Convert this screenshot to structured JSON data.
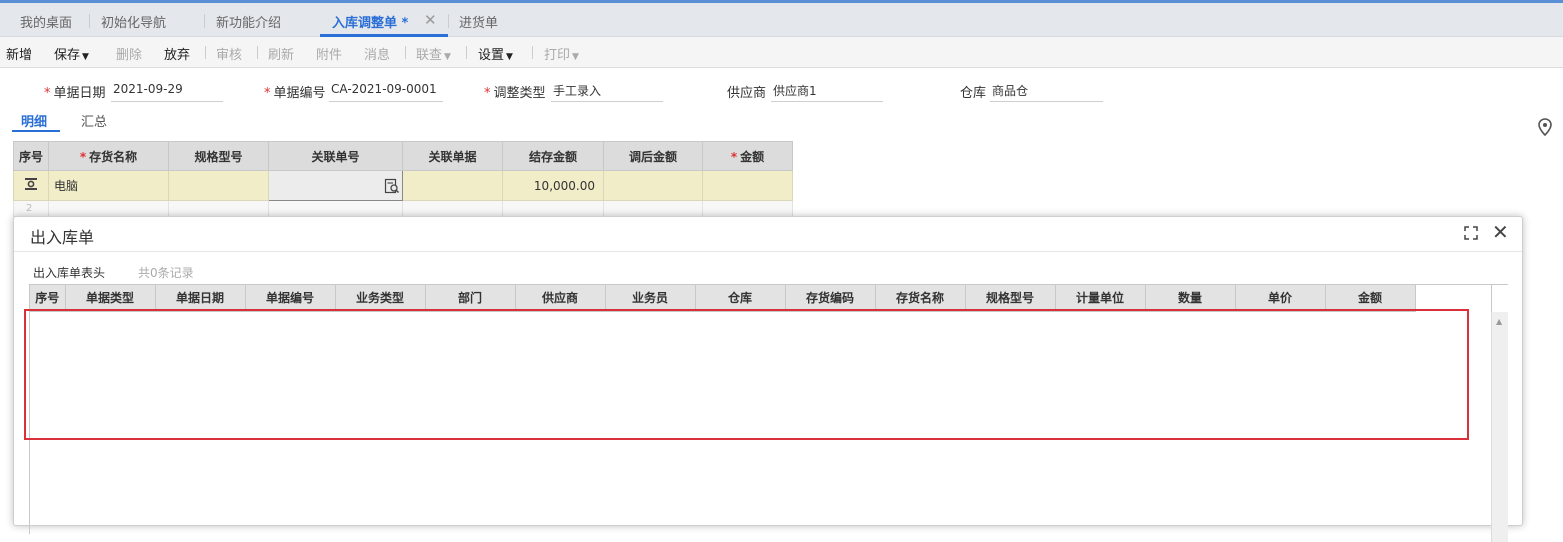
{
  "tabs": [
    {
      "label": "我的桌面"
    },
    {
      "label": "初始化导航"
    },
    {
      "label": "新功能介绍"
    },
    {
      "label": "入库调整单 *"
    },
    {
      "label": "进货单"
    }
  ],
  "toolbar": {
    "new": "新增",
    "save": "保存",
    "delete": "删除",
    "discard": "放弃",
    "audit": "审核",
    "refresh": "刷新",
    "attach": "附件",
    "message": "消息",
    "linked": "联查",
    "settings": "设置",
    "print": "打印"
  },
  "form": {
    "date_label": "单据日期",
    "date_value": "2021-09-29",
    "code_label": "单据编号",
    "code_value": "CA-2021-09-0001",
    "type_label": "调整类型",
    "type_value": "手工录入",
    "supplier_label": "供应商",
    "supplier_value": "供应商1",
    "warehouse_label": "仓库",
    "warehouse_value": "商品仓"
  },
  "subtabs": [
    "明细",
    "汇总"
  ],
  "grid": {
    "headers": [
      "序号",
      "存货名称",
      "规格型号",
      "关联单号",
      "关联单据",
      "结存金额",
      "调后金额",
      "金额"
    ],
    "rows": [
      {
        "name": "电脑",
        "balance": "10,000.00"
      }
    ],
    "row2_index": "2"
  },
  "dialog": {
    "title": "出入库单",
    "subtitle": "出入库单表头",
    "count": "共0条记录",
    "headers": [
      "序号",
      "单据类型",
      "单据日期",
      "单据编号",
      "业务类型",
      "部门",
      "供应商",
      "业务员",
      "仓库",
      "存货编码",
      "存货名称",
      "规格型号",
      "计量单位",
      "数量",
      "单价",
      "金额"
    ]
  },
  "colors": {
    "accent": "#2a6fd6",
    "row_highlight": "#f1edc8",
    "required": "#e03030",
    "annotation_box": "#d9303a"
  }
}
